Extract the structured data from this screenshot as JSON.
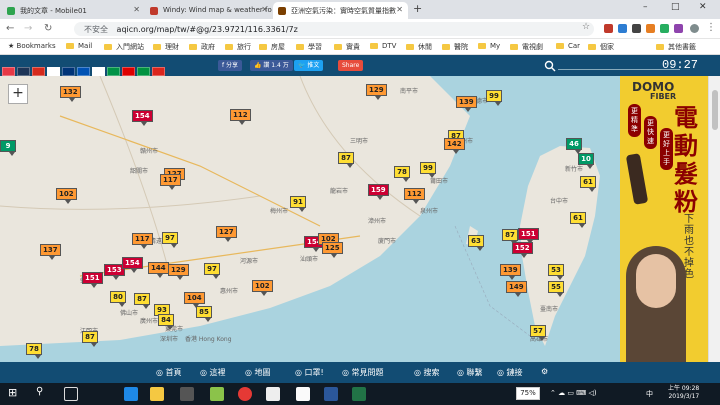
{
  "browser": {
    "tabs": [
      {
        "label": "我的文章 - Mobile01",
        "color": "#2ea44f"
      },
      {
        "label": "Windy: Wind map & weather fo",
        "color": "#c0392b"
      },
      {
        "label": "亞洲空氣污染：實時空氣質量指數",
        "color": "#7b3f00"
      }
    ],
    "new_tab": "+",
    "window_controls": [
      "–",
      "□",
      "✕"
    ],
    "insecure_label": "不安全",
    "url": "aqicn.org/map/tw/#@g/23.9721/116.3361/7z",
    "bookmarks": [
      "Bookmarks",
      "Mail",
      "入門網站",
      "理財",
      "政府",
      "旅行",
      "房屋",
      "學習",
      "實貴",
      "DTV",
      "休閒",
      "醫院",
      "My",
      "電視劇",
      "Car",
      "個家"
    ],
    "bookmarks_more": "其他書籤"
  },
  "site_bar": {
    "flag_colors": [
      "#e63946",
      "#1d3557",
      "#d52b1e",
      "#ffffff",
      "#003478",
      "#0052b4",
      "#ffffff",
      "#009246",
      "#dd0000",
      "#00923f",
      "#da251d"
    ],
    "share_label": "分享",
    "like_label": "讚 1.4 万",
    "tweet_label": "推文",
    "share2_label": "Share",
    "clock": "09:27"
  },
  "map": {
    "zoom_in": "+",
    "zoom_out": "−",
    "cities": [
      {
        "label": "贛州市"
      },
      {
        "label": "韶關市"
      },
      {
        "label": "廣州市"
      },
      {
        "label": "佛山市"
      },
      {
        "label": "江門市"
      },
      {
        "label": "深圳市"
      },
      {
        "label": "東莞市"
      },
      {
        "label": "香港 Hong Kong"
      },
      {
        "label": "汕頭市"
      },
      {
        "label": "潮州市"
      },
      {
        "label": "廈門市"
      },
      {
        "label": "泉州市"
      },
      {
        "label": "漳州市"
      },
      {
        "label": "龍岩市"
      },
      {
        "label": "莆田市"
      },
      {
        "label": "福州市"
      },
      {
        "label": "三明市"
      },
      {
        "label": "寧德市"
      },
      {
        "label": "南平市"
      },
      {
        "label": "梅州市"
      },
      {
        "label": "河源市"
      },
      {
        "label": "惠州市"
      },
      {
        "label": "清遠市"
      },
      {
        "label": "肇慶市"
      },
      {
        "label": "高雄市"
      },
      {
        "label": "臺南市"
      },
      {
        "label": "台中市"
      },
      {
        "label": "新竹市"
      }
    ],
    "markers": [
      {
        "value": "132"
      },
      {
        "value": "129"
      },
      {
        "value": "139"
      },
      {
        "value": "99"
      },
      {
        "value": "154"
      },
      {
        "value": "112"
      },
      {
        "value": "87"
      },
      {
        "value": "142"
      },
      {
        "value": "46"
      },
      {
        "value": "127"
      },
      {
        "value": "117"
      },
      {
        "value": "87"
      },
      {
        "value": "78"
      },
      {
        "value": "99"
      },
      {
        "value": "61"
      },
      {
        "value": "102"
      },
      {
        "value": "159"
      },
      {
        "value": "112"
      },
      {
        "value": "91"
      },
      {
        "value": "137"
      },
      {
        "value": "117"
      },
      {
        "value": "97"
      },
      {
        "value": "127"
      },
      {
        "value": "154"
      },
      {
        "value": "102"
      },
      {
        "value": "63"
      },
      {
        "value": "87"
      },
      {
        "value": "151"
      },
      {
        "value": "61"
      },
      {
        "value": "151"
      },
      {
        "value": "153"
      },
      {
        "value": "154"
      },
      {
        "value": "144"
      },
      {
        "value": "129"
      },
      {
        "value": "97"
      },
      {
        "value": "125"
      },
      {
        "value": "152"
      },
      {
        "value": "139"
      },
      {
        "value": "53"
      },
      {
        "value": "80"
      },
      {
        "value": "87"
      },
      {
        "value": "104"
      },
      {
        "value": "102"
      },
      {
        "value": "149"
      },
      {
        "value": "55"
      },
      {
        "value": "93"
      },
      {
        "value": "84"
      },
      {
        "value": "85"
      },
      {
        "value": "87"
      },
      {
        "value": "78"
      },
      {
        "value": "57"
      },
      {
        "value": "9"
      },
      {
        "value": "10"
      }
    ]
  },
  "ad": {
    "brand": "DOMO",
    "brand_sub": "FIBER",
    "headline": "電動髮粉",
    "tags": [
      "更精準",
      "更快速",
      "更好上手"
    ],
    "sub": "下雨也不掉色"
  },
  "bottom_nav": [
    "首頁",
    "這裡",
    "地圖",
    "口罩!",
    "常見問題",
    "搜索",
    "聯繫",
    "鏈接"
  ],
  "taskbar": {
    "battery": "75%",
    "ime": "中",
    "time": "上午 09:28",
    "date": "2019/3/17"
  }
}
